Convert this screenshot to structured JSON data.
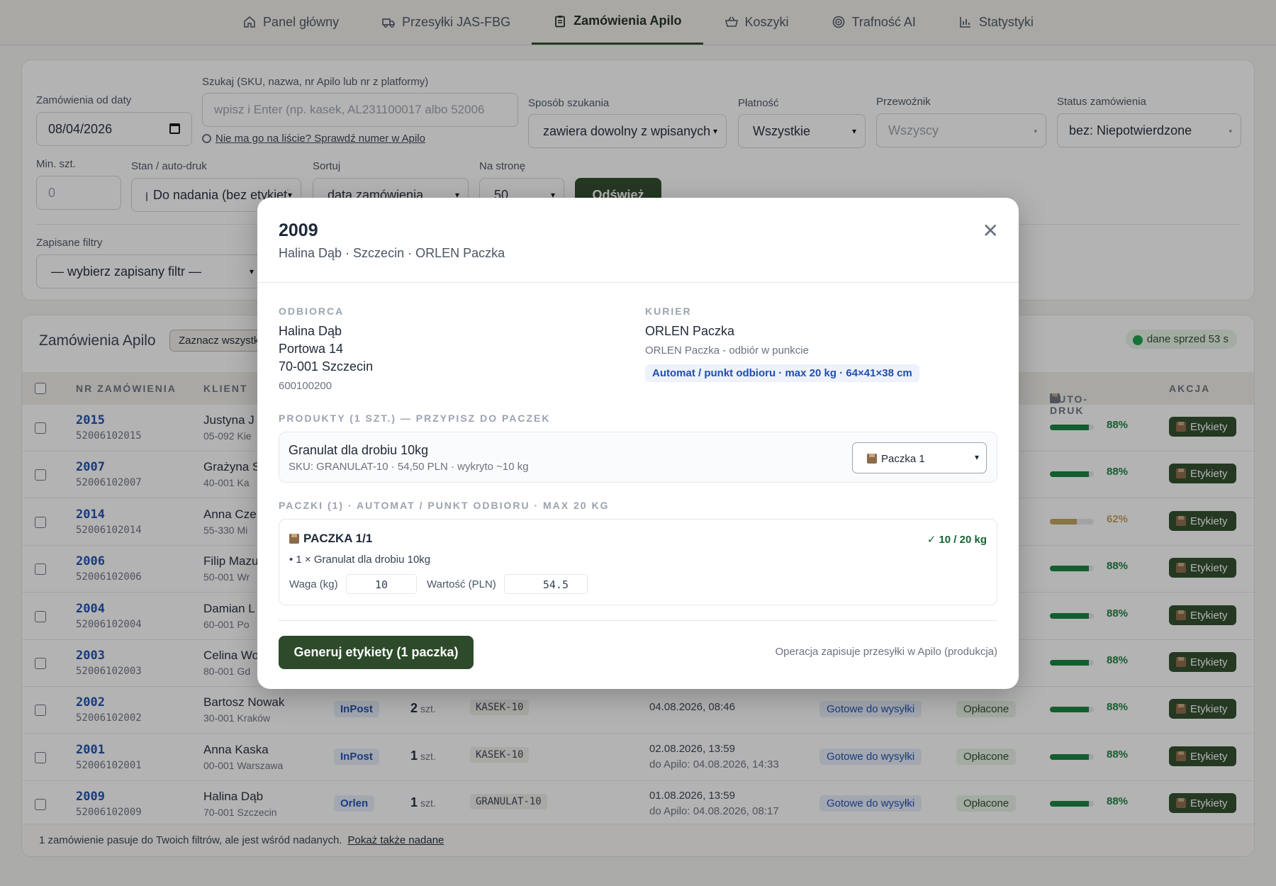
{
  "nav": {
    "tabs": [
      {
        "label": "Panel główny",
        "icon": "home-icon"
      },
      {
        "label": "Przesyłki JAS-FBG",
        "icon": "truck-icon"
      },
      {
        "label": "Zamówienia Apilo",
        "icon": "clipboard-icon"
      },
      {
        "label": "Koszyki",
        "icon": "basket-icon"
      },
      {
        "label": "Trafność AI",
        "icon": "target-icon"
      },
      {
        "label": "Statystyki",
        "icon": "bar-chart-icon"
      }
    ],
    "active": "Zamówienia Apilo"
  },
  "filters": {
    "date_label": "Zamówienia od daty",
    "date_value": "08/04/2026",
    "search_label": "Szukaj (SKU, nazwa, nr Apilo lub nr z platformy)",
    "search_placeholder": "wpisz i Enter (np. kasek, AL231100017 albo 52006",
    "search_hint": "Nie ma go na liście? Sprawdź numer w Apilo",
    "mode_label": "Sposób szukania",
    "mode_value": "zawiera dowolny z wpisanych",
    "payment_label": "Płatność",
    "payment_value": "Wszystkie",
    "carrier_label": "Przewoźnik",
    "carrier_value": "Wszyscy",
    "status_label": "Status zamówienia",
    "status_value": "bez: Niepotwierdzone",
    "min_label": "Min. szt.",
    "min_placeholder": "0",
    "state_label": "Stan / auto-druk",
    "state_value": "Do nadania (bez etykiet)",
    "sort_label": "Sortuj",
    "sort_value": "data zamówienia",
    "per_page_label": "Na stronę",
    "per_page_value": "50",
    "refresh_label": "Odśwież",
    "saved_label": "Zapisane filtry",
    "saved_value": "— wybierz zapisany filtr —"
  },
  "orders": {
    "title": "Zamówienia Apilo",
    "select_all": "Zaznacz wszystkie",
    "live_badge": "dane sprzed 53 s",
    "headers": {
      "nr": "NR ZAMÓWIENIA",
      "client": "KLIENT",
      "autoprint": "AUTO-DRUK",
      "action": "AKCJA"
    },
    "action_label": "Etykiety",
    "rows": [
      {
        "nr": "2015",
        "sub": "52006102015",
        "client": "Justyna J",
        "city": "05-092 Kie",
        "pct": "88%",
        "level": 0.88,
        "color": "#15803d"
      },
      {
        "nr": "2007",
        "sub": "52006102007",
        "client": "Grażyna S",
        "city": "40-001 Ka",
        "pct": "88%",
        "level": 0.88,
        "color": "#15803d"
      },
      {
        "nr": "2014",
        "sub": "52006102014",
        "client": "Anna Cze",
        "city": "55-330 Mi",
        "pct": "62%",
        "level": 0.62,
        "color": "#c2a35a"
      },
      {
        "nr": "2006",
        "sub": "52006102006",
        "client": "Filip Mazu",
        "city": "50-001 Wr",
        "pct": "88%",
        "level": 0.88,
        "color": "#15803d"
      },
      {
        "nr": "2004",
        "sub": "52006102004",
        "client": "Damian L",
        "city": "60-001 Po",
        "pct": "88%",
        "level": 0.88,
        "color": "#15803d"
      },
      {
        "nr": "2003",
        "sub": "52006102003",
        "client": "Celina Wo",
        "city": "80-001 Gd",
        "pct": "88%",
        "level": 0.88,
        "color": "#15803d"
      },
      {
        "nr": "2002",
        "sub": "52006102002",
        "client": "Bartosz Nowak",
        "city": "30-001 Kraków",
        "carrier": "InPost",
        "qty": "2",
        "unit": "szt.",
        "sku": "KASEK-10",
        "date": "04.08.2026, 08:46",
        "date2": "",
        "status": "Gotowe do wysyłki",
        "payment": "Opłacone",
        "pct": "88%",
        "level": 0.88,
        "color": "#15803d"
      },
      {
        "nr": "2001",
        "sub": "52006102001",
        "client": "Anna Kaska",
        "city": "00-001 Warszawa",
        "carrier": "InPost",
        "qty": "1",
        "unit": "szt.",
        "sku": "KASEK-10",
        "date": "02.08.2026, 13:59",
        "date2": "do Apilo: 04.08.2026, 14:33",
        "status": "Gotowe do wysyłki",
        "payment": "Opłacone",
        "pct": "88%",
        "level": 0.88,
        "color": "#15803d"
      },
      {
        "nr": "2009",
        "sub": "52006102009",
        "client": "Halina Dąb",
        "city": "70-001 Szczecin",
        "carrier": "Orlen",
        "qty": "1",
        "unit": "szt.",
        "sku": "GRANULAT-10",
        "date": "01.08.2026, 13:59",
        "date2": "do Apilo: 04.08.2026, 08:17",
        "status": "Gotowe do wysyłki",
        "payment": "Opłacone",
        "pct": "88%",
        "level": 0.88,
        "color": "#15803d"
      }
    ],
    "footnote": "1 zamówienie pasuje do Twoich filtrów, ale jest wśród nadanych.",
    "footnote_link": "Pokaż także nadane"
  },
  "modal": {
    "title": "2009",
    "subtitle": "Halina Dąb · Szczecin · ORLEN Paczka",
    "recipient_label": "ODBIORCA",
    "recipient_name": "Halina Dąb",
    "recipient_street": "Portowa 14",
    "recipient_city": "70-001 Szczecin",
    "recipient_phone": "600100200",
    "courier_label": "KURIER",
    "courier_name": "ORLEN Paczka",
    "courier_service": "ORLEN Paczka - odbiór w punkcie",
    "courier_tag": "Automat / punkt odbioru · max 20 kg · 64×41×38 cm",
    "products_label": "PRODUKTY (1 SZT.) — PRZYPISZ DO PACZEK",
    "product_name": "Granulat dla drobiu 10kg",
    "product_meta": "SKU: GRANULAT-10 · 54,50 PLN · wykryto ~10 kg",
    "product_package": "Paczka 1",
    "packages_label": "PACZKI (1) · AUTOMAT / PUNKT ODBIORU · MAX 20 KG",
    "package_title": "PACZKA 1/1",
    "package_weight_ok": "✓ 10 / 20 kg",
    "package_item": "• 1 × Granulat dla drobiu 10kg",
    "weight_label": "Waga (kg)",
    "weight_value": "10",
    "value_label": "Wartość (PLN)",
    "value_value": "54.5",
    "generate_label": "Generuj etykiety (1 paczka)",
    "note": "Operacja zapisuje przesyłki w Apilo (produkcja)",
    "close_icon": "close-icon"
  }
}
